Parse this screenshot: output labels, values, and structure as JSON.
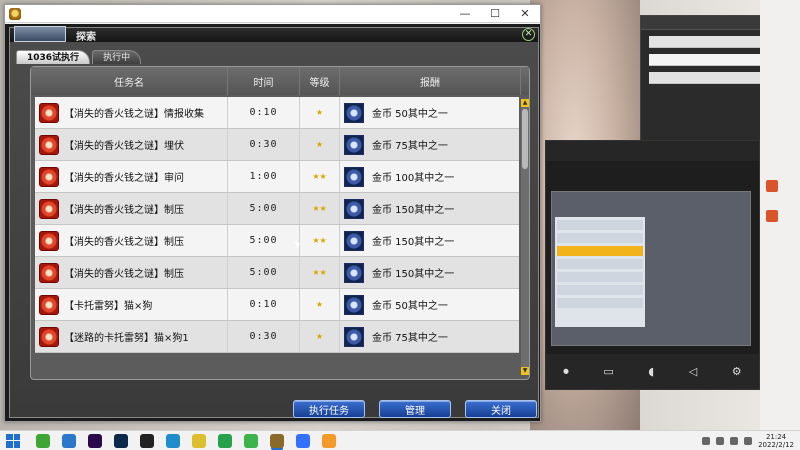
{
  "window": {
    "title": "",
    "minimize_glyph": "—",
    "maximize_glyph": "☐",
    "close_glyph": "✕"
  },
  "panel": {
    "title": "探索",
    "close_glyph": "✕",
    "emblem_text": ""
  },
  "tabs": [
    {
      "label": "1036试执行",
      "active": true
    },
    {
      "label": "执行中",
      "active": false
    }
  ],
  "table": {
    "headers": {
      "name": "任务名",
      "time": "时间",
      "level": "等级",
      "reward": "报酬"
    },
    "rows": [
      {
        "name": "【消失的香火钱之谜】情报收集",
        "time": "0:10",
        "level": "★",
        "reward": "金币  50其中之一"
      },
      {
        "name": "【消失的香火钱之谜】埋伏",
        "time": "0:30",
        "level": "★",
        "reward": "金币  75其中之一"
      },
      {
        "name": "【消失的香火钱之谜】审问",
        "time": "1:00",
        "level": "★★",
        "reward": "金币  100其中之一"
      },
      {
        "name": "【消失的香火钱之谜】制压",
        "time": "5:00",
        "level": "★★",
        "reward": "金币  150其中之一"
      },
      {
        "name": "【消失的香火钱之谜】制压",
        "time": "5:00",
        "level": "★★",
        "reward": "金币  150其中之一"
      },
      {
        "name": "【消失的香火钱之谜】制压",
        "time": "5:00",
        "level": "★★",
        "reward": "金币  150其中之一"
      },
      {
        "name": "【卡托雷努】猫×狗",
        "time": "0:10",
        "level": "★",
        "reward": "金币  50其中之一"
      },
      {
        "name": "【迷路的卡托雷努】猫×狗1",
        "time": "0:30",
        "level": "★",
        "reward": "金币  75其中之一"
      }
    ]
  },
  "buttons": {
    "execute": "执行任务",
    "manage": "管理",
    "close": "关闭"
  },
  "taskbar": {
    "time": "21:24",
    "date": "2022/2/12",
    "apps": [
      {
        "icon": "360-browser-icon",
        "color": "#3fa535"
      },
      {
        "icon": "app-blue-icon",
        "color": "#2b77c9"
      },
      {
        "icon": "premiere-icon",
        "color": "#2a0a4a"
      },
      {
        "icon": "photoshop-icon",
        "color": "#0b2a4a"
      },
      {
        "icon": "qq-icon",
        "color": "#222222"
      },
      {
        "icon": "edge-icon",
        "color": "#1e8ecb"
      },
      {
        "icon": "chrome-icon",
        "color": "#dcbf2e"
      },
      {
        "icon": "upload-icon",
        "color": "#25a24a"
      },
      {
        "icon": "wechat-icon",
        "color": "#3cb44b"
      },
      {
        "icon": "game-client-icon",
        "color": "#8a6a2a"
      },
      {
        "icon": "feishu-icon",
        "color": "#3370ff"
      },
      {
        "icon": "obs-icon",
        "color": "#f29b2b"
      }
    ]
  },
  "colors": {
    "accent_blue": "#1f4fa8",
    "star_gold": "#d6a800",
    "highlight_orange": "#f2b21a"
  }
}
